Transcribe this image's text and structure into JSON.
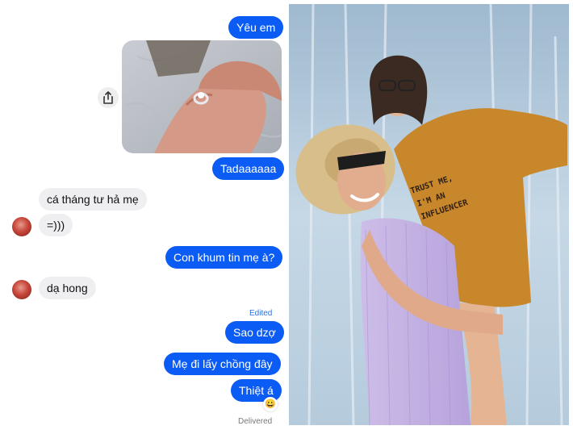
{
  "chat": {
    "messages": [
      {
        "side": "out",
        "text": "Yêu em"
      },
      {
        "side": "out",
        "type": "photo",
        "icon": "ring-photo"
      },
      {
        "side": "out",
        "text": "Tadaaaaaa"
      },
      {
        "side": "in",
        "text": "cá tháng tư hả mẹ"
      },
      {
        "side": "in",
        "text": "=)))"
      },
      {
        "side": "out",
        "text": "Con khum tin mẹ à?"
      },
      {
        "side": "in",
        "text": "dạ hong"
      },
      {
        "side": "out",
        "text": "Sao dzợ"
      },
      {
        "side": "out",
        "text": "Mẹ đi lấy chồng đây"
      },
      {
        "side": "out",
        "text": "Thiệt á"
      }
    ],
    "edited_label": "Edited",
    "status": "Delivered",
    "reaction": "😀",
    "share_icon": "share-icon"
  },
  "photo": {
    "shirt_lines": [
      "TRUST ME,",
      "I'M AN",
      "INFLUENCER"
    ]
  },
  "colors": {
    "outgoing_bubble": "#0a5cf5",
    "incoming_bubble": "#efeff1",
    "edited_text": "#2f6fd6"
  }
}
